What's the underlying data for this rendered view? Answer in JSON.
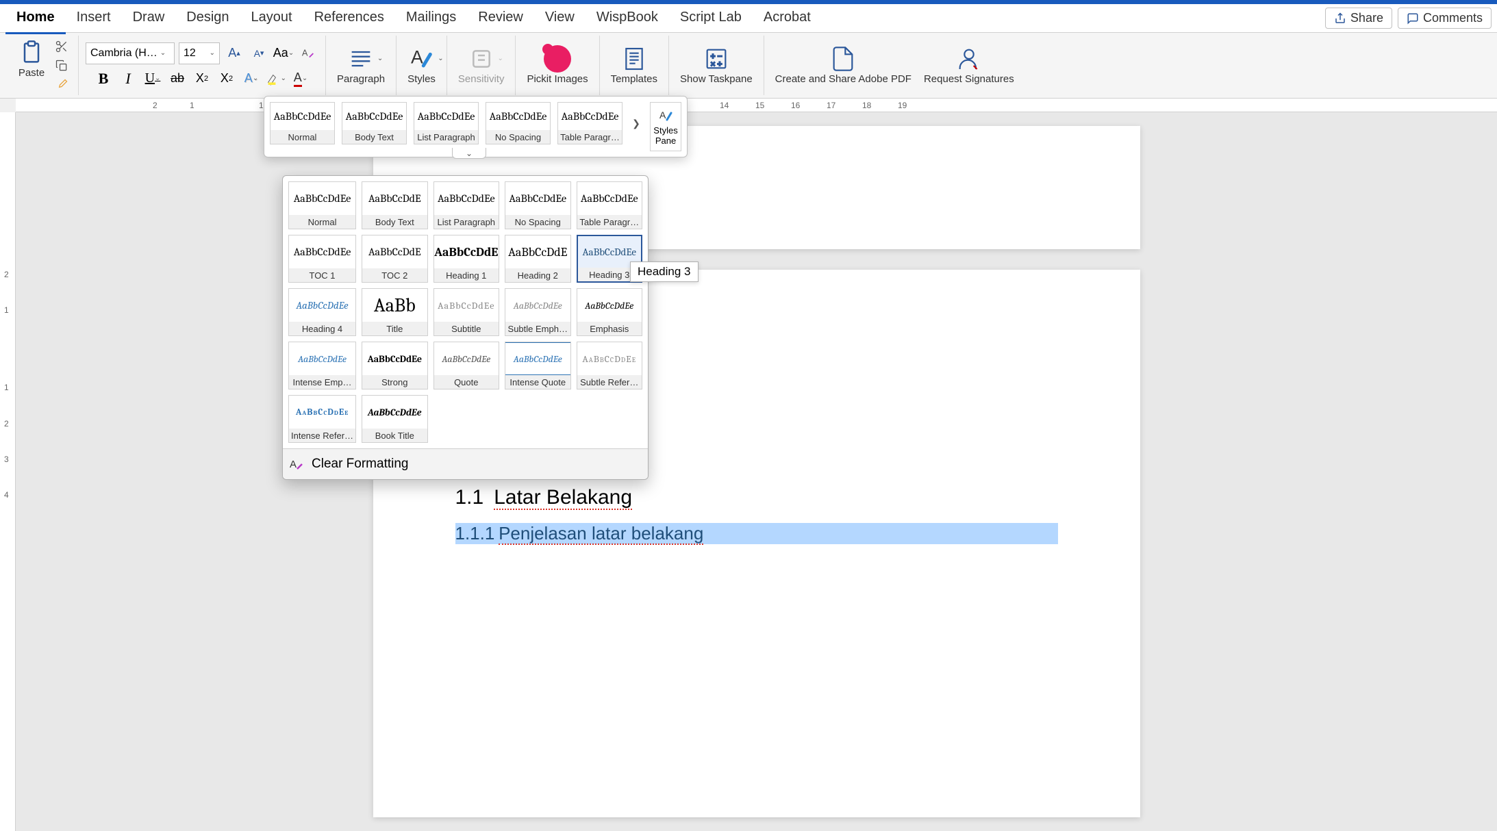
{
  "tabs": {
    "items": [
      "Home",
      "Insert",
      "Draw",
      "Design",
      "Layout",
      "References",
      "Mailings",
      "Review",
      "View",
      "WispBook",
      "Script Lab",
      "Acrobat"
    ],
    "active": 0,
    "share": "Share",
    "comments": "Comments"
  },
  "ribbon": {
    "paste": "Paste",
    "font_name": "Cambria (H…",
    "font_size": "12",
    "paragraph": "Paragraph",
    "styles": "Styles",
    "sensitivity": "Sensitivity",
    "pickit": "Pickit Images",
    "templates": "Templates",
    "show_taskpane": "Show Taskpane",
    "create_share_pdf": "Create and Share Adobe PDF",
    "request_sig": "Request Signatures"
  },
  "styles_row": {
    "sample": "AaBbCcDdEe",
    "items": [
      "Normal",
      "Body Text",
      "List Paragraph",
      "No Spacing",
      "Table Paragr…"
    ],
    "pane": "Styles Pane"
  },
  "styles_dropdown": {
    "sample": "AaBbCcDdEe",
    "sample_short": "AaBbCcDdE",
    "sample_h1": "AaBbCcDdE",
    "sample_title": "AaBb",
    "sample_sc": "AaBbCcDdEe",
    "rows": [
      [
        "Normal",
        "Body Text",
        "List Paragraph",
        "No Spacing",
        "Table Paragr…"
      ],
      [
        "TOC 1",
        "TOC 2",
        "Heading 1",
        "Heading 2",
        "Heading 3"
      ],
      [
        "Heading 4",
        "Title",
        "Subtitle",
        "Subtle Emph…",
        "Emphasis"
      ],
      [
        "Intense Emp…",
        "Strong",
        "Quote",
        "Intense Quote",
        "Subtle Refer…"
      ],
      [
        "Intense Refer…",
        "Book Title"
      ]
    ],
    "clear": "Clear Formatting",
    "tooltip": "Heading 3"
  },
  "ruler_h": [
    "2",
    "1",
    "1",
    "14",
    "15",
    "16",
    "17",
    "18",
    "19"
  ],
  "ruler_v": [
    "2",
    "1",
    "1",
    "2",
    "3",
    "4"
  ],
  "document": {
    "h2_num": "1.1",
    "h2_text": "Latar Belakang",
    "h3_num": "1.1.1",
    "h3_text": "Penjelasan latar belakang"
  }
}
